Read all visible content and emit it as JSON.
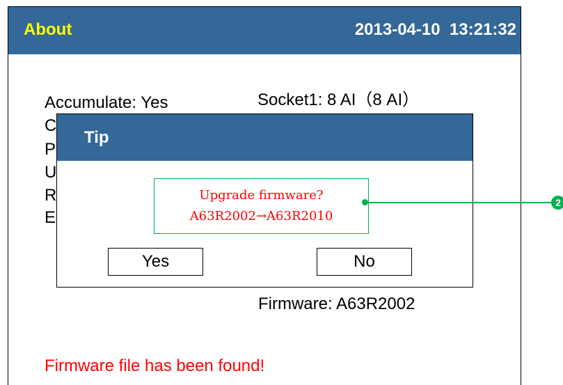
{
  "header": {
    "title": "About",
    "datetime": "2013-04-10  13:21:32"
  },
  "info": {
    "accumulate": "Accumulate: Yes",
    "socket1": "Socket1: 8 AI（8 AI）",
    "hidden_initials": [
      "C",
      "P",
      "U",
      "R",
      "E"
    ],
    "firmware": "Firmware: A63R2002"
  },
  "status_message": "Firmware file has been found!",
  "dialog": {
    "title": "Tip",
    "message_line1": "Upgrade firmware?",
    "message_line2": "A63R2002→A63R2010",
    "yes_label": "Yes",
    "no_label": "No"
  },
  "callout": {
    "number": "2"
  },
  "colors": {
    "titlebar": "#336898",
    "title_text": "#ffff00",
    "message_text": "#ff0000",
    "callout": "#00b050"
  }
}
